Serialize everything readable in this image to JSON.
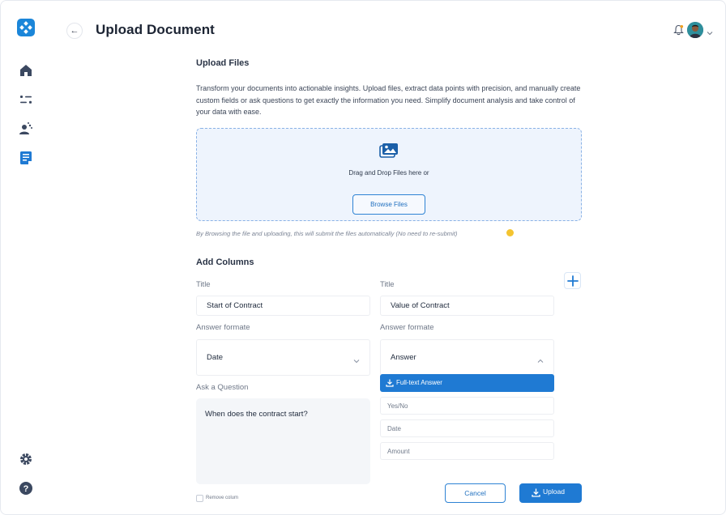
{
  "header": {
    "back_icon": "arrow-left-icon",
    "title": "Upload Document",
    "notification_icon": "bell-icon"
  },
  "sidebar": {
    "items": [
      {
        "icon": "home-icon"
      },
      {
        "icon": "sliders-icon"
      },
      {
        "icon": "users-spark-icon"
      },
      {
        "icon": "document-list-icon"
      }
    ],
    "bottom": [
      {
        "icon": "gear-icon"
      },
      {
        "icon": "help-icon"
      }
    ]
  },
  "upload": {
    "heading": "Upload Files",
    "description": "Transform your documents into actionable insights. Upload files, extract data points with precision, and manually create custom fields or ask questions to get exactly the information you need. Simplify document analysis and take control of your data with ease.",
    "dropzone_text": "Drag and Drop Files here or",
    "browse_label": "Browse Files",
    "note": "By Browsing the file and uploading, this will submit the files automatically (No need to re-submit)"
  },
  "columns": {
    "heading": "Add Columns",
    "left": {
      "title_label": "Title",
      "title_value": "Start of Contract",
      "format_label": "Answer formate",
      "format_value": "Date",
      "question_label": "Ask a Question",
      "question_value": "When does the contract start?"
    },
    "right": {
      "title_label": "Title",
      "title_value": "Value of Contract",
      "format_label": "Answer formate",
      "format_value": "Answer",
      "options": [
        "Full-text Answer",
        "Yes/No",
        "Date",
        "Amount"
      ]
    },
    "remove_label": "Remove colum"
  },
  "actions": {
    "cancel_label": "Cancel",
    "upload_label": "Upload"
  },
  "colors": {
    "accent": "#1f7ad3",
    "dropzone_bg": "#eef4fd"
  }
}
